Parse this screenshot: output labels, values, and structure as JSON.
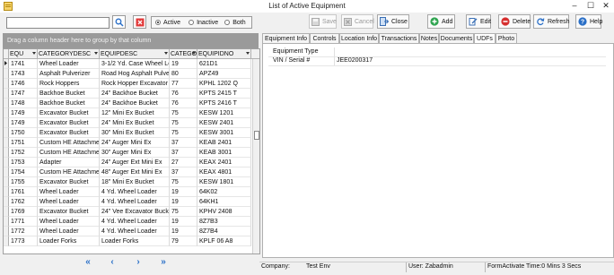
{
  "window": {
    "title": "List of Active Equipment",
    "minimize": "–",
    "maximize": "☐",
    "close": "✕"
  },
  "search": {
    "value": "",
    "placeholder": ""
  },
  "filter": {
    "options": [
      "Active",
      "Inactive",
      "Both"
    ],
    "selected": "Active"
  },
  "toolbar": {
    "save": "Save",
    "cancel": "Cancel",
    "close": "Close",
    "add": "Add",
    "edit": "Edit",
    "delete": "Delete",
    "refresh": "Refresh",
    "help": "Help"
  },
  "grid": {
    "group_hint": "Drag a column header here to group by that column",
    "columns": [
      "EQU",
      "CATEGORYDESC",
      "EQUIPDESC",
      "CATEGO",
      "EQUIPIDNO"
    ],
    "rows": [
      [
        "1741",
        "Wheel Loader",
        "3-1/2 Yd. Case Wheel Lo",
        "19",
        "621D1"
      ],
      [
        "1743",
        "Asphalt Pulverizer",
        "Road Hog Asphalt Pulver",
        "80",
        "APZ49"
      ],
      [
        "1746",
        "Rock Hoppers",
        "Rock Hopper Excavator E",
        "77",
        "KPHL 1202 Q"
      ],
      [
        "1747",
        "Backhoe Bucket",
        "24\" Backhoe Bucket",
        "76",
        "KPTS 2415 T"
      ],
      [
        "1748",
        "Backhoe Bucket",
        "24\" Backhoe Bucket",
        "76",
        "KPTS 2416 T"
      ],
      [
        "1749",
        "Excavator Bucket",
        "12\" Mini Ex Bucket",
        "75",
        "KESW 1201"
      ],
      [
        "1749",
        "Excavator Bucket",
        "24\" Mini Ex Bucket",
        "75",
        "KESW 2401"
      ],
      [
        "1750",
        "Excavator Bucket",
        "30\" Mini Ex Bucket",
        "75",
        "KESW 3001"
      ],
      [
        "1751",
        "Custom HE Attachmen",
        "24\" Auger Mini Ex",
        "37",
        "KEAB 2401"
      ],
      [
        "1752",
        "Custom HE Attachmen",
        "30\" Auger Mini Ex",
        "37",
        "KEAB 3001"
      ],
      [
        "1753",
        "Adapter",
        "24\" Auger Ext Mini Ex",
        "27",
        "KEAX 2401"
      ],
      [
        "1754",
        "Custom HE Attachmen",
        "48\" Auger Ext Mini Ex",
        "37",
        "KEAX 4801"
      ],
      [
        "1755",
        "Excavator Bucket",
        "18\" Mini Ex Bucket",
        "75",
        "KESW 1801"
      ],
      [
        "1761",
        "Wheel Loader",
        "4 Yd. Wheel Loader",
        "19",
        "64K02"
      ],
      [
        "1762",
        "Wheel Loader",
        "4 Yd. Wheel Loader",
        "19",
        "64KH1"
      ],
      [
        "1769",
        "Excavator Bucket",
        "24\" Vee Excavator Bucke",
        "75",
        "KPHV 2408"
      ],
      [
        "1771",
        "Wheel Loader",
        "4 Yd. Wheel Loader",
        "19",
        "8Z7B3"
      ],
      [
        "1772",
        "Wheel Loader",
        "4 Yd. Wheel Loader",
        "19",
        "8Z7B4"
      ],
      [
        "1773",
        "Loader Forks",
        "Loader Forks",
        "79",
        "KPLF 06 A8"
      ]
    ]
  },
  "nav": {
    "first": "«",
    "prev": "‹",
    "next": "›",
    "last": "»"
  },
  "tabs": [
    {
      "label": "Equipment Info",
      "active": false
    },
    {
      "label": "Controls",
      "active": false
    },
    {
      "label": "Location Info",
      "active": false
    },
    {
      "label": "Transactions",
      "active": false
    },
    {
      "label": "Notes",
      "active": false
    },
    {
      "label": "Documents",
      "active": false
    },
    {
      "label": "UDFs",
      "active": true
    },
    {
      "label": "Photo",
      "active": false
    }
  ],
  "udfs": [
    {
      "key": "Equipment Type",
      "value": ""
    },
    {
      "key": "VIN / Serial #",
      "value": "JEE0200317"
    }
  ],
  "status": {
    "company_label": "Company:",
    "company": "Test Env",
    "user": "User: Zabadmin",
    "timing": "FormActivate Time:0 Mins 3 Secs"
  }
}
